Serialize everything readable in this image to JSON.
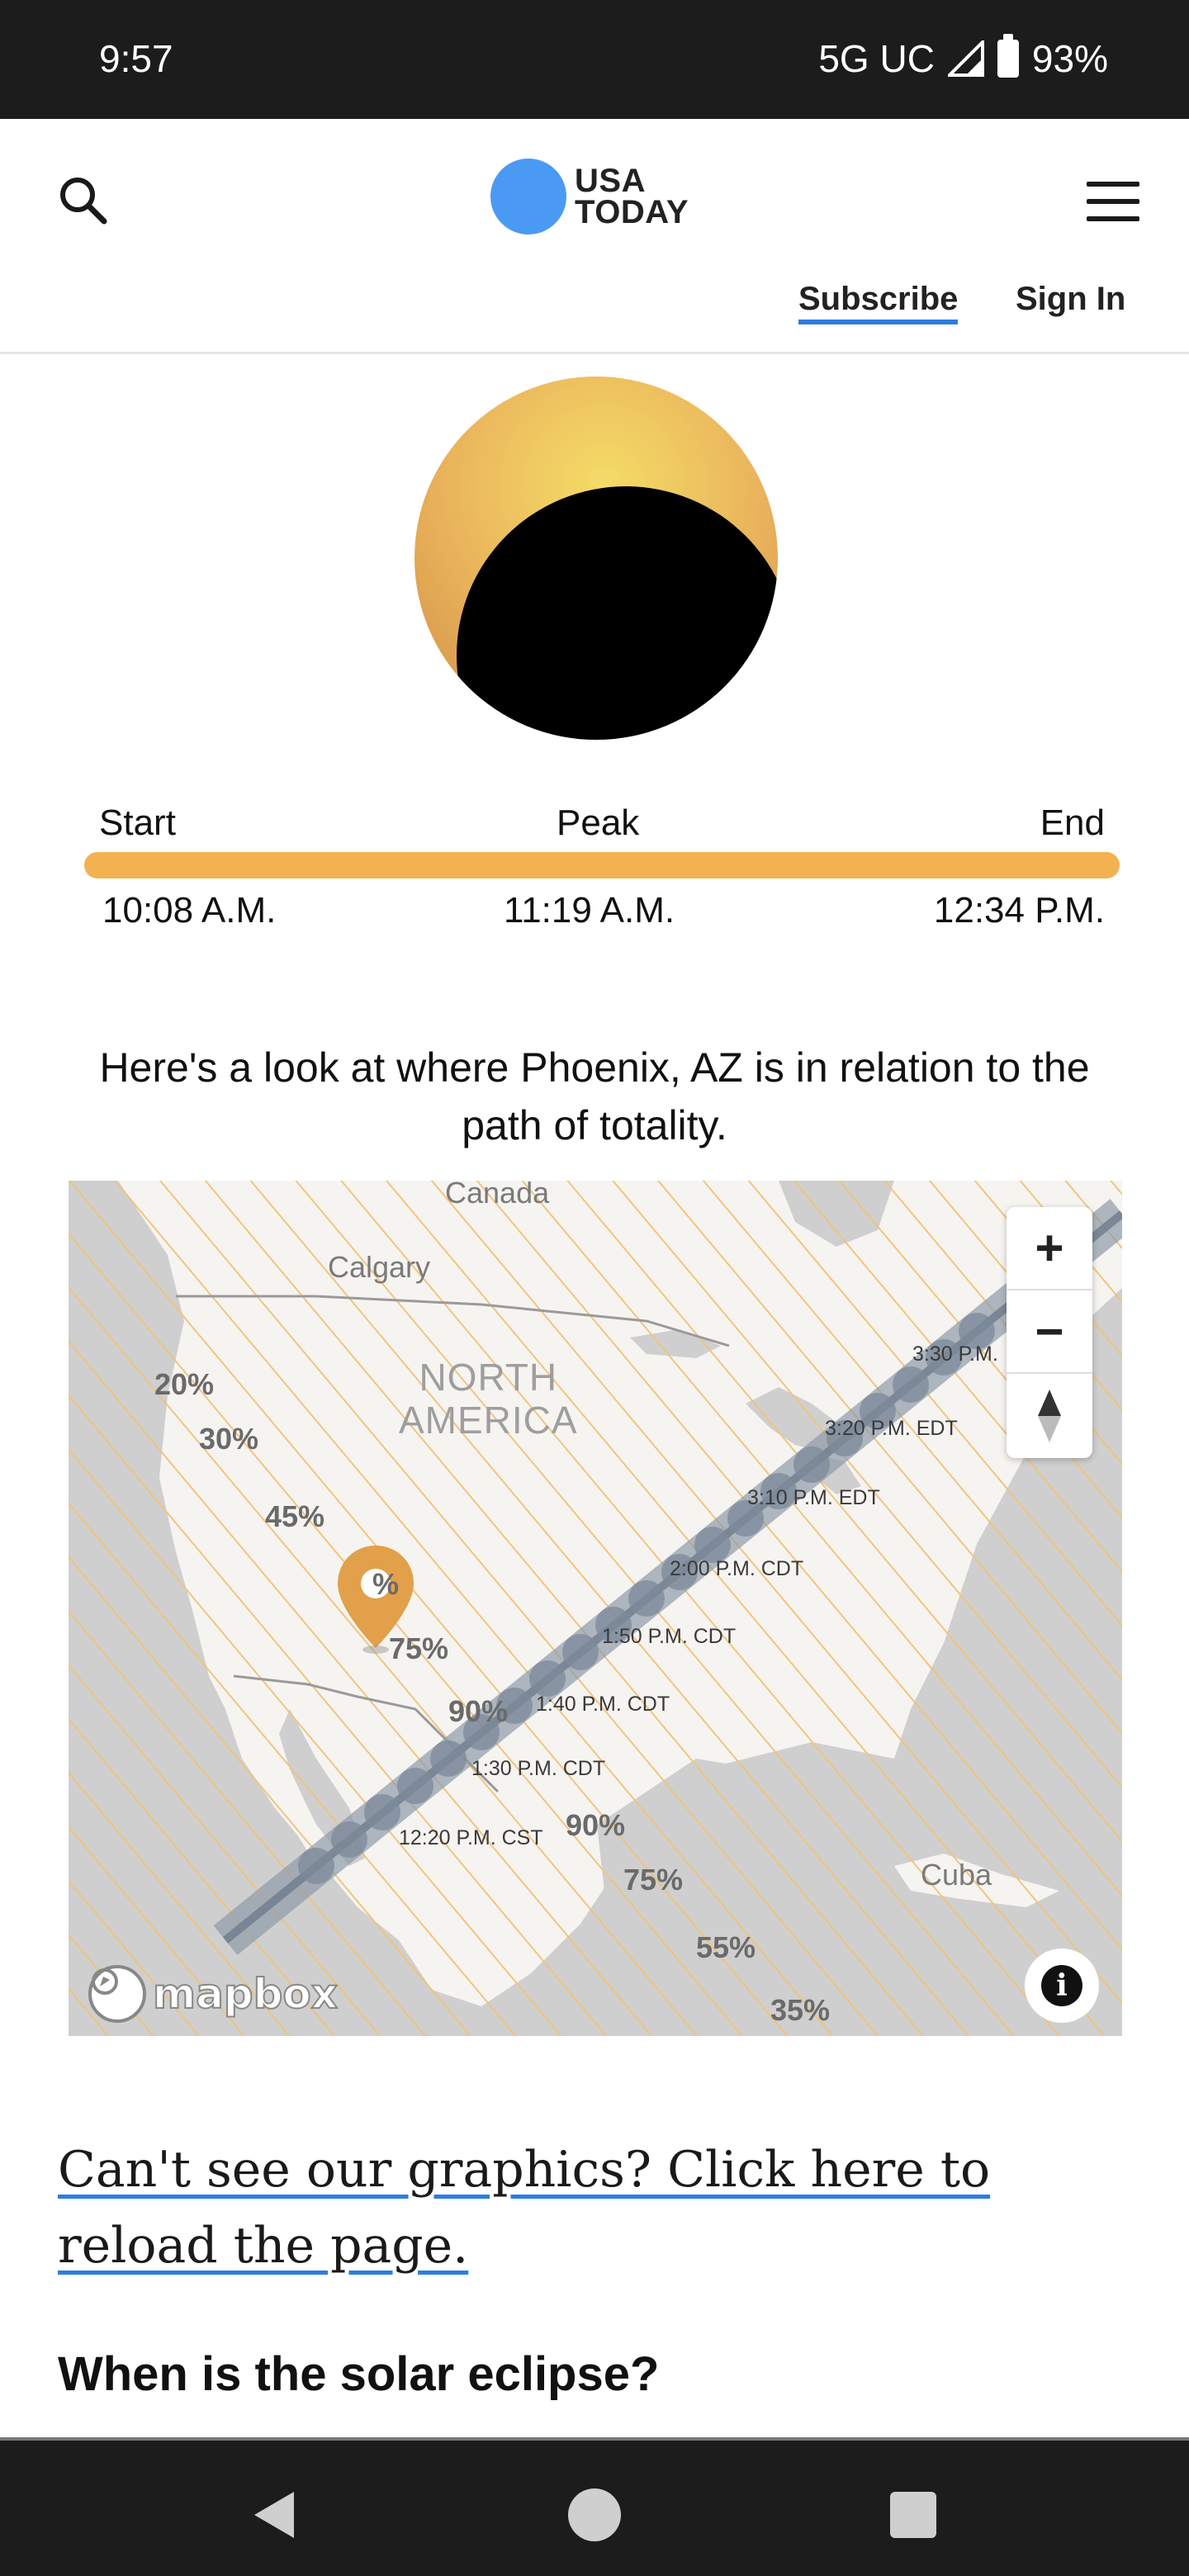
{
  "status_bar": {
    "time": "9:57",
    "network": "5G UC",
    "battery": "93%"
  },
  "header": {
    "logo_line1": "USA",
    "logo_line2": "TODAY",
    "subscribe_label": "Subscribe",
    "signin_label": "Sign In",
    "logo_color": "#4a9af4"
  },
  "eclipse": {
    "start_label": "Start",
    "peak_label": "Peak",
    "end_label": "End",
    "start_time": "10:08 A.M.",
    "peak_time": "11:19 A.M.",
    "end_time": "12:34 P.M.",
    "bar_color": "#f3b251"
  },
  "intro_text": "Here's a look at where Phoenix, AZ is in relation to the path of totality.",
  "map": {
    "labels": {
      "canada": "Canada",
      "calgary": "Calgary",
      "north": "NORTH",
      "america": "AMERICA",
      "cuba": "Cuba"
    },
    "percentages": [
      "20%",
      "30%",
      "45%",
      "%",
      "75%",
      "90%",
      "90%",
      "75%",
      "55%",
      "35%"
    ],
    "path_times": [
      "3:30 P.M.",
      "3:20 P.M. EDT",
      "3:10 P.M. EDT",
      "2:00 P.M. CDT",
      "1:50 P.M. CDT",
      "1:40 P.M. CDT",
      "1:30 P.M. CDT",
      "12:20 P.M. CST"
    ],
    "zoom_in": "+",
    "zoom_out": "−",
    "attribution": "mapbox",
    "info": "i"
  },
  "reload_link": "Can't see our graphics? Click here to reload the page.",
  "section_heading": "When is the solar eclipse?"
}
